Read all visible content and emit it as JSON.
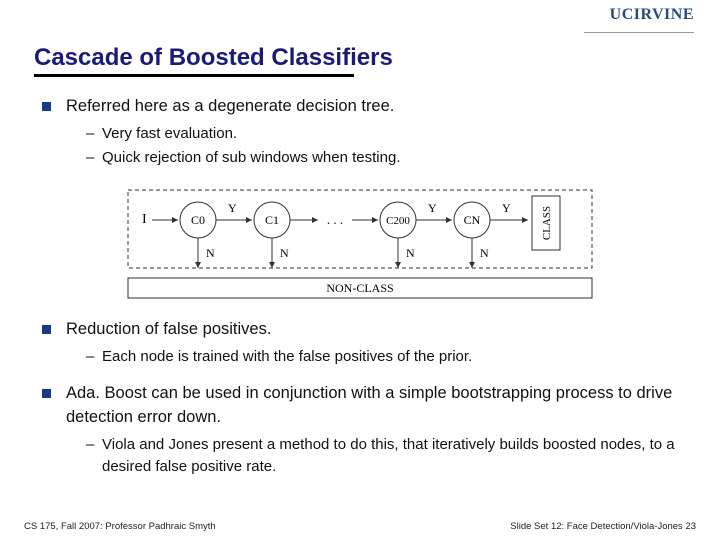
{
  "header": {
    "logo_text_1": "UC",
    "logo_text_2": "IRVINE"
  },
  "title": "Cascade of Boosted Classifiers",
  "bullets": [
    {
      "text": "Referred here as a degenerate decision tree.",
      "sub": [
        "Very fast evaluation.",
        "Quick rejection of sub windows when testing."
      ]
    },
    {
      "text": "Reduction of false positives.",
      "sub": [
        "Each node is trained with the false positives of the prior."
      ]
    },
    {
      "text": "Ada. Boost can be used in conjunction with a simple bootstrapping process to drive detection error down.",
      "sub": [
        "Viola and Jones present a method to do this, that iteratively builds boosted nodes, to a desired false positive rate."
      ]
    }
  ],
  "diagram": {
    "input_label": "I",
    "yes_label": "Y",
    "no_label": "N",
    "nodes": [
      "C0",
      "C1",
      "C200",
      "CN"
    ],
    "ellipsis": ". . .",
    "class_label": "CLASS",
    "nonclass_label": "NON-CLASS"
  },
  "footer": {
    "left": "CS 175, Fall 2007: Professor Padhraic Smyth",
    "right": "Slide Set 12: Face Detection/Viola-Jones 23"
  }
}
